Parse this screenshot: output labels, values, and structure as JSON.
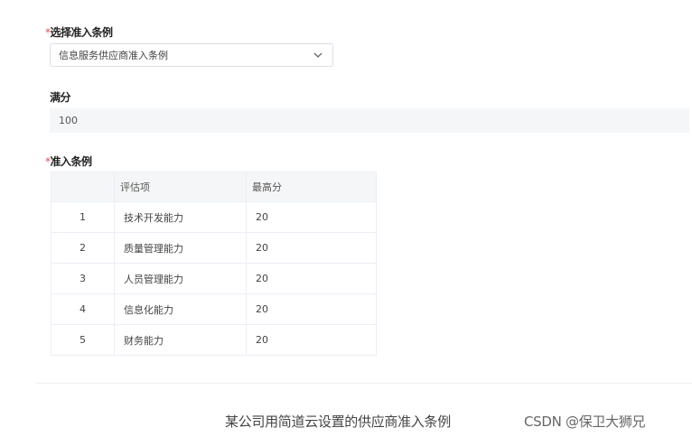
{
  "form": {
    "select_criteria": {
      "required_mark": "*",
      "label": "选择准入条例",
      "value": "信息服务供应商准入条例",
      "chevron_icon": "chevron-down-icon"
    },
    "full_score": {
      "label": "满分",
      "value": "100"
    },
    "criteria": {
      "required_mark": "*",
      "label": "准入条例",
      "columns": [
        "",
        "评估项",
        "最高分"
      ],
      "rows": [
        {
          "index": "1",
          "item": "技术开发能力",
          "max": "20"
        },
        {
          "index": "2",
          "item": "质量管理能力",
          "max": "20"
        },
        {
          "index": "3",
          "item": "人员管理能力",
          "max": "20"
        },
        {
          "index": "4",
          "item": "信息化能力",
          "max": "20"
        },
        {
          "index": "5",
          "item": "财务能力",
          "max": "20"
        }
      ]
    }
  },
  "caption": "某公司用简道云设置的供应商准入条例",
  "watermark": "CSDN @保卫大狮兄"
}
